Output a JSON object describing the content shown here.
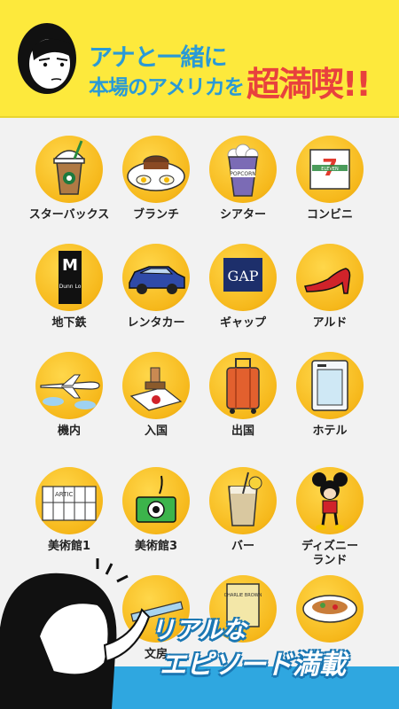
{
  "banner": {
    "line1": "アナと一緒に",
    "line2": "本場のアメリカを",
    "line3": "超満喫!!"
  },
  "items": [
    {
      "label": "スターバックス",
      "icon": "coffee-icon"
    },
    {
      "label": "ブランチ",
      "icon": "brunch-plate-icon"
    },
    {
      "label": "シアター",
      "icon": "popcorn-icon"
    },
    {
      "label": "コンビニ",
      "icon": "seven-eleven-icon",
      "icon_text": "ELEVEN"
    },
    {
      "label": "地下鉄",
      "icon": "subway-sign-icon",
      "icon_text": "Dunn Lo"
    },
    {
      "label": "レンタカー",
      "icon": "car-icon"
    },
    {
      "label": "ギャップ",
      "icon": "gap-logo-icon",
      "icon_text": "GAP"
    },
    {
      "label": "アルド",
      "icon": "high-heel-icon"
    },
    {
      "label": "機内",
      "icon": "airplane-icon"
    },
    {
      "label": "入国",
      "icon": "passport-stamp-icon"
    },
    {
      "label": "出国",
      "icon": "suitcase-icon"
    },
    {
      "label": "ホテル",
      "icon": "hotel-fridge-icon"
    },
    {
      "label": "美術館1",
      "icon": "museum-building-icon",
      "icon_text": "ARTIC"
    },
    {
      "label": "美術館3",
      "icon": "camera-icon"
    },
    {
      "label": "バー",
      "icon": "drink-glass-icon"
    },
    {
      "label": "ディズニー\nランド",
      "icon": "mickey-icon"
    },
    {
      "label": "文房",
      "icon": "stationery-icon"
    },
    {
      "label": "",
      "icon": "book-icon",
      "icon_text": "CHARLIE BROWN"
    },
    {
      "label": "",
      "icon": "dinner-plate-icon"
    }
  ],
  "slogan": {
    "line1": "リアルな",
    "line2": "エピソード満載"
  },
  "colors": {
    "banner_bg": "#fde93c",
    "headline_blue": "#2a9ad6",
    "headline_red": "#e8413d",
    "circle_yellow": "#f6b81b",
    "band_blue": "#2fa7e0"
  }
}
